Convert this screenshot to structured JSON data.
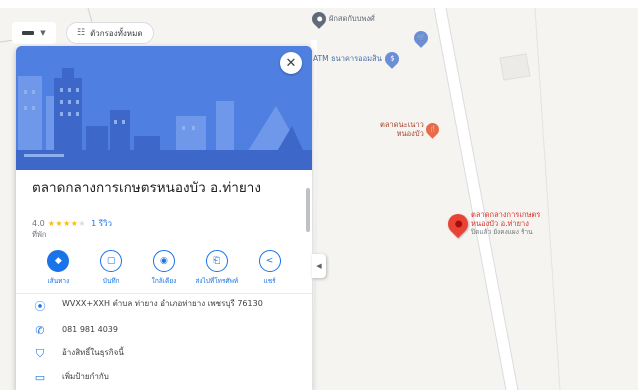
{
  "map": {
    "pois": {
      "top_shop": "ผักสดกับบพงศ์",
      "atm": "ATM ธนาคารออมสิน",
      "market_small": [
        "ตลาดนะเนาว",
        "หนองบัว"
      ],
      "main_marker": {
        "name": [
          "ตลาดกลางการเกษตร",
          "หนองบัว อ.ท่ายาง"
        ],
        "sub": "ปิดแล้ว ยังคงแผง ร้าน"
      }
    }
  },
  "controls": {
    "filter_label": "ตัวกรองทั้งหมด"
  },
  "panel": {
    "title": "ตลาดกลางการเกษตรหนองบัว อ.ท่ายาง",
    "rating_value": "4.0",
    "review_count": "1 รีวิว",
    "rating": 4,
    "rating_max": 5,
    "category": "ที่พัก",
    "actions": [
      {
        "label": "เส้นทาง",
        "icon": "directions-icon",
        "glyph": "◆"
      },
      {
        "label": "บันทึก",
        "icon": "bookmark-icon",
        "glyph": "▢"
      },
      {
        "label": "ใกล้เคียง",
        "icon": "nearby-icon",
        "glyph": "◉"
      },
      {
        "label": "ส่งไปที่โทรศัพท์",
        "icon": "send-to-phone-icon",
        "glyph": "⎗"
      },
      {
        "label": "แชร์",
        "icon": "share-icon",
        "glyph": "<"
      }
    ],
    "details": [
      {
        "icon": "location-pin-icon",
        "glyph": "⦿",
        "text": "WVXX+XXH ตำบล ท่ายาง อำเภอท่ายาง เพชรบุรี 76130"
      },
      {
        "icon": "phone-icon",
        "glyph": "✆",
        "text": "081 981 4039"
      },
      {
        "icon": "verified-icon",
        "glyph": "⛉",
        "text": "อ้างสิทธิ์ในธุรกิจนี้"
      },
      {
        "icon": "label-icon",
        "glyph": "▭",
        "text": "เพิ่มป้ายกำกับ"
      }
    ]
  },
  "colors": {
    "accent": "#1a73e8",
    "hero": "#4a78de",
    "marker": "#ea4335",
    "star": "#fbbc04"
  }
}
